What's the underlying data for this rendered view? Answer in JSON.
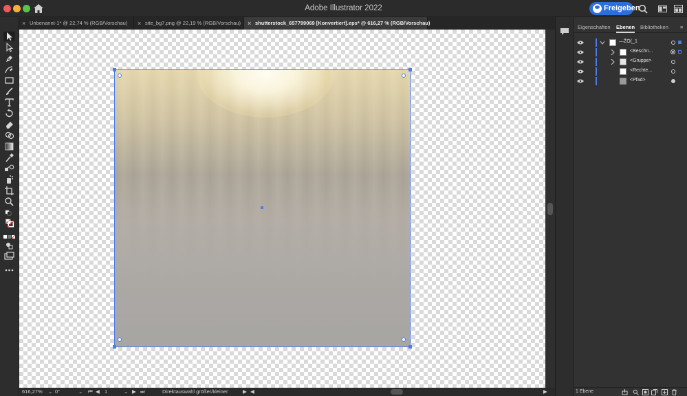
{
  "app": {
    "title": "Adobe Illustrator 2022",
    "share_label": "Freigeben"
  },
  "tabs": [
    {
      "label": "Unbenannt-1* @ 22,74 % (RGB/Vorschau)",
      "active": false
    },
    {
      "label": "site_bg7.png @ 22,19 % (RGB/Vorschau)",
      "active": false
    },
    {
      "label": "shutterstock_657799069 [Konvertiert].eps* @ 616,27 % (RGB/Vorschau)",
      "active": true
    }
  ],
  "tools": [
    {
      "name": "selection-tool",
      "icon": "arrow-black"
    },
    {
      "name": "direct-selection-tool",
      "icon": "arrow-white"
    },
    {
      "name": "pen-tool",
      "icon": "pen"
    },
    {
      "name": "curvature-tool",
      "icon": "pen-curve"
    },
    {
      "name": "rectangle-tool",
      "icon": "rectangle"
    },
    {
      "name": "paintbrush-tool",
      "icon": "brush"
    },
    {
      "name": "type-tool",
      "icon": "type-T"
    },
    {
      "name": "rotate-tool",
      "icon": "rotate"
    },
    {
      "name": "eraser-tool",
      "icon": "eraser"
    },
    {
      "name": "shape-builder-tool",
      "icon": "shape-builder"
    },
    {
      "name": "gradient-tool",
      "icon": "gradient"
    },
    {
      "name": "eyedropper-tool",
      "icon": "eyedropper"
    },
    {
      "name": "blend-tool",
      "icon": "blend"
    },
    {
      "name": "symbol-sprayer-tool",
      "icon": "spray"
    },
    {
      "name": "artboard-tool",
      "icon": "artboard"
    },
    {
      "name": "zoom-tool",
      "icon": "magnifier"
    }
  ],
  "status": {
    "zoom": "616,27%",
    "rotation": "0°",
    "artboard": "1",
    "hint": "Direktauswahl größer/kleiner"
  },
  "panel": {
    "tabs": [
      "Eigenschaften",
      "Ebenen",
      "Bibliotheken"
    ],
    "active_tab": "Ebenen",
    "layers": [
      {
        "name": "—ŽÓ(_1",
        "expandable": true,
        "expanded": true,
        "indent": 0,
        "thumb": "white"
      },
      {
        "name": "<Beschn...",
        "expandable": true,
        "expanded": false,
        "indent": 1,
        "thumb": "white-dot"
      },
      {
        "name": "<Gruppe>",
        "expandable": true,
        "expanded": false,
        "indent": 1,
        "thumb": "light"
      },
      {
        "name": "<Rechte...",
        "expandable": false,
        "expanded": false,
        "indent": 1,
        "thumb": "white"
      },
      {
        "name": "<Pfad>",
        "expandable": false,
        "expanded": false,
        "indent": 1,
        "thumb": "gray"
      }
    ],
    "footer_count": "1 Ebene"
  },
  "colors": {
    "accent": "#4e7bea",
    "share_button": "#2c6fdb",
    "ui_bg": "#323232"
  }
}
